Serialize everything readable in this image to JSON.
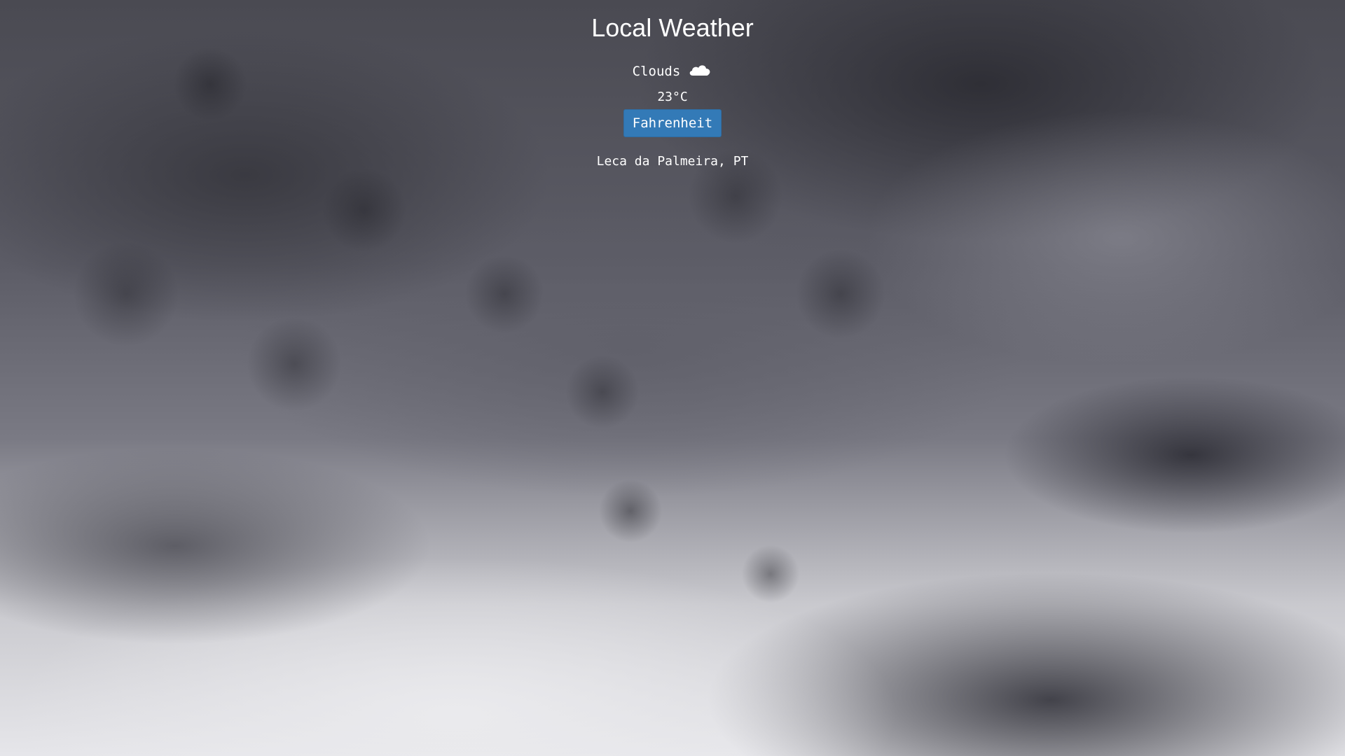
{
  "app": {
    "title": "Local Weather"
  },
  "weather": {
    "condition": "Clouds",
    "condition_icon": "cloud-icon",
    "temperature": "23°C"
  },
  "controls": {
    "unit_toggle_label": "Fahrenheit"
  },
  "location": {
    "text": "Leca da Palmeira, PT"
  },
  "colors": {
    "button_bg": "#337ab7",
    "text": "#ffffff"
  }
}
